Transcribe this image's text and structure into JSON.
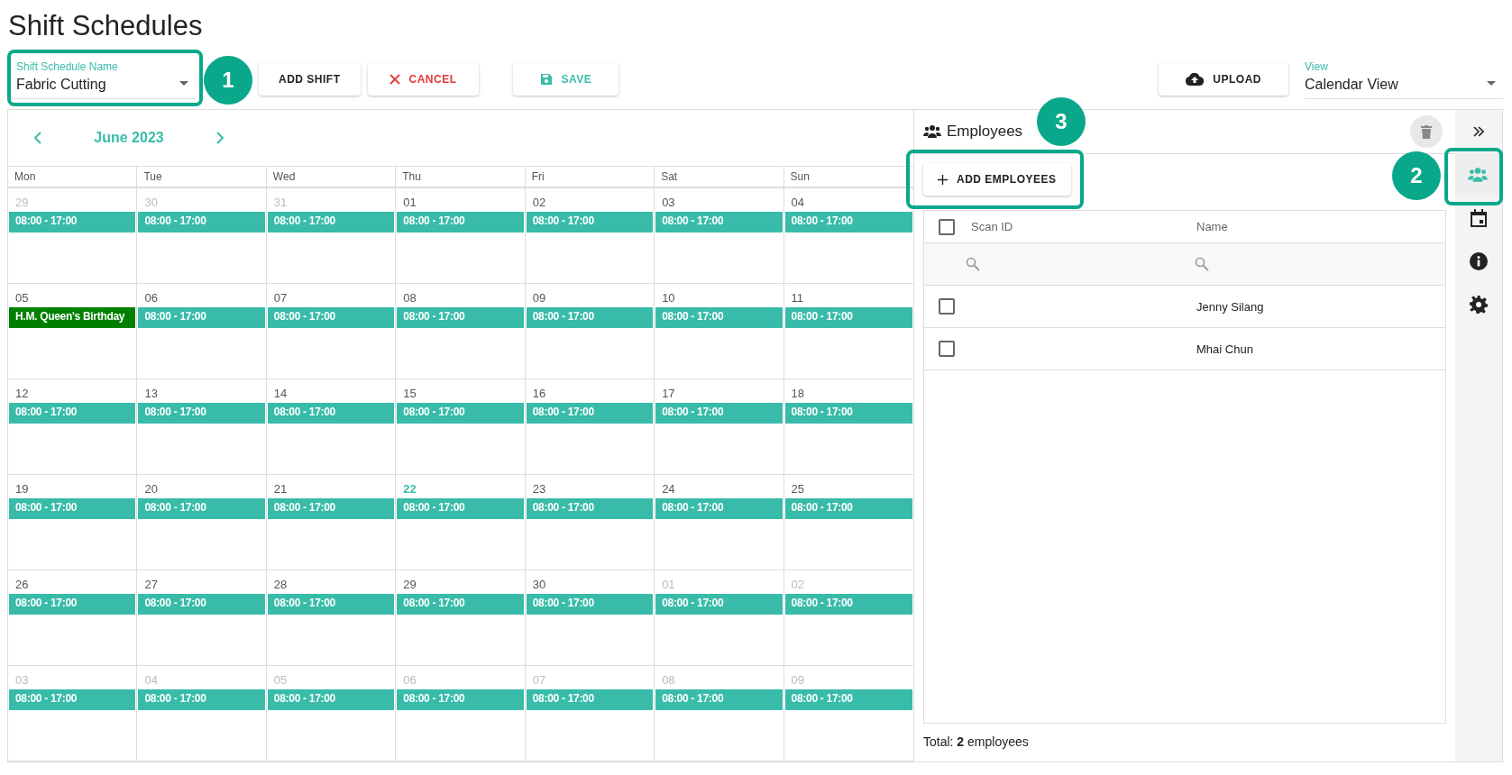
{
  "page_title": "Shift Schedules",
  "schedule_field": {
    "label": "Shift Schedule Name",
    "value": "Fabric Cutting"
  },
  "toolbar": [
    {
      "kind": "add",
      "label": "ADD SHIFT"
    },
    {
      "kind": "cancel",
      "label": "CANCEL"
    },
    {
      "kind": "save",
      "label": "SAVE"
    }
  ],
  "upload_button": {
    "label": "UPLOAD"
  },
  "view_field": {
    "label": "View",
    "value": "Calendar View"
  },
  "calendar": {
    "month": "June 2023",
    "weekdays": [
      "Mon",
      "Tue",
      "Wed",
      "Thu",
      "Fri",
      "Sat",
      "Sun"
    ],
    "weeks": [
      [
        {
          "day": "29",
          "outside": true,
          "today": false,
          "event": {
            "label": "08:00 - 17:00",
            "kind": "shift"
          }
        },
        {
          "day": "30",
          "outside": true,
          "today": false,
          "event": {
            "label": "08:00 - 17:00",
            "kind": "shift"
          }
        },
        {
          "day": "31",
          "outside": true,
          "today": false,
          "event": {
            "label": "08:00 - 17:00",
            "kind": "shift"
          }
        },
        {
          "day": "01",
          "outside": false,
          "today": false,
          "event": {
            "label": "08:00 - 17:00",
            "kind": "shift"
          }
        },
        {
          "day": "02",
          "outside": false,
          "today": false,
          "event": {
            "label": "08:00 - 17:00",
            "kind": "shift"
          }
        },
        {
          "day": "03",
          "outside": false,
          "today": false,
          "event": {
            "label": "08:00 - 17:00",
            "kind": "shift"
          }
        },
        {
          "day": "04",
          "outside": false,
          "today": false,
          "event": {
            "label": "08:00 - 17:00",
            "kind": "shift"
          }
        }
      ],
      [
        {
          "day": "05",
          "outside": false,
          "today": false,
          "event": {
            "label": "H.M. Queen's Birthday",
            "kind": "holiday"
          }
        },
        {
          "day": "06",
          "outside": false,
          "today": false,
          "event": {
            "label": "08:00 - 17:00",
            "kind": "shift"
          }
        },
        {
          "day": "07",
          "outside": false,
          "today": false,
          "event": {
            "label": "08:00 - 17:00",
            "kind": "shift"
          }
        },
        {
          "day": "08",
          "outside": false,
          "today": false,
          "event": {
            "label": "08:00 - 17:00",
            "kind": "shift"
          }
        },
        {
          "day": "09",
          "outside": false,
          "today": false,
          "event": {
            "label": "08:00 - 17:00",
            "kind": "shift"
          }
        },
        {
          "day": "10",
          "outside": false,
          "today": false,
          "event": {
            "label": "08:00 - 17:00",
            "kind": "shift"
          }
        },
        {
          "day": "11",
          "outside": false,
          "today": false,
          "event": {
            "label": "08:00 - 17:00",
            "kind": "shift"
          }
        }
      ],
      [
        {
          "day": "12",
          "outside": false,
          "today": false,
          "event": {
            "label": "08:00 - 17:00",
            "kind": "shift"
          }
        },
        {
          "day": "13",
          "outside": false,
          "today": false,
          "event": {
            "label": "08:00 - 17:00",
            "kind": "shift"
          }
        },
        {
          "day": "14",
          "outside": false,
          "today": false,
          "event": {
            "label": "08:00 - 17:00",
            "kind": "shift"
          }
        },
        {
          "day": "15",
          "outside": false,
          "today": false,
          "event": {
            "label": "08:00 - 17:00",
            "kind": "shift"
          }
        },
        {
          "day": "16",
          "outside": false,
          "today": false,
          "event": {
            "label": "08:00 - 17:00",
            "kind": "shift"
          }
        },
        {
          "day": "17",
          "outside": false,
          "today": false,
          "event": {
            "label": "08:00 - 17:00",
            "kind": "shift"
          }
        },
        {
          "day": "18",
          "outside": false,
          "today": false,
          "event": {
            "label": "08:00 - 17:00",
            "kind": "shift"
          }
        }
      ],
      [
        {
          "day": "19",
          "outside": false,
          "today": false,
          "event": {
            "label": "08:00 - 17:00",
            "kind": "shift"
          }
        },
        {
          "day": "20",
          "outside": false,
          "today": false,
          "event": {
            "label": "08:00 - 17:00",
            "kind": "shift"
          }
        },
        {
          "day": "21",
          "outside": false,
          "today": false,
          "event": {
            "label": "08:00 - 17:00",
            "kind": "shift"
          }
        },
        {
          "day": "22",
          "outside": false,
          "today": true,
          "event": {
            "label": "08:00 - 17:00",
            "kind": "shift"
          }
        },
        {
          "day": "23",
          "outside": false,
          "today": false,
          "event": {
            "label": "08:00 - 17:00",
            "kind": "shift"
          }
        },
        {
          "day": "24",
          "outside": false,
          "today": false,
          "event": {
            "label": "08:00 - 17:00",
            "kind": "shift"
          }
        },
        {
          "day": "25",
          "outside": false,
          "today": false,
          "event": {
            "label": "08:00 - 17:00",
            "kind": "shift"
          }
        }
      ],
      [
        {
          "day": "26",
          "outside": false,
          "today": false,
          "event": {
            "label": "08:00 - 17:00",
            "kind": "shift"
          }
        },
        {
          "day": "27",
          "outside": false,
          "today": false,
          "event": {
            "label": "08:00 - 17:00",
            "kind": "shift"
          }
        },
        {
          "day": "28",
          "outside": false,
          "today": false,
          "event": {
            "label": "08:00 - 17:00",
            "kind": "shift"
          }
        },
        {
          "day": "29",
          "outside": false,
          "today": false,
          "event": {
            "label": "08:00 - 17:00",
            "kind": "shift"
          }
        },
        {
          "day": "30",
          "outside": false,
          "today": false,
          "event": {
            "label": "08:00 - 17:00",
            "kind": "shift"
          }
        },
        {
          "day": "01",
          "outside": true,
          "today": false,
          "event": {
            "label": "08:00 - 17:00",
            "kind": "shift"
          }
        },
        {
          "day": "02",
          "outside": true,
          "today": false,
          "event": {
            "label": "08:00 - 17:00",
            "kind": "shift"
          }
        }
      ],
      [
        {
          "day": "03",
          "outside": true,
          "today": false,
          "event": {
            "label": "08:00 - 17:00",
            "kind": "shift"
          }
        },
        {
          "day": "04",
          "outside": true,
          "today": false,
          "event": {
            "label": "08:00 - 17:00",
            "kind": "shift"
          }
        },
        {
          "day": "05",
          "outside": true,
          "today": false,
          "event": {
            "label": "08:00 - 17:00",
            "kind": "shift"
          }
        },
        {
          "day": "06",
          "outside": true,
          "today": false,
          "event": {
            "label": "08:00 - 17:00",
            "kind": "shift"
          }
        },
        {
          "day": "07",
          "outside": true,
          "today": false,
          "event": {
            "label": "08:00 - 17:00",
            "kind": "shift"
          }
        },
        {
          "day": "08",
          "outside": true,
          "today": false,
          "event": {
            "label": "08:00 - 17:00",
            "kind": "shift"
          }
        },
        {
          "day": "09",
          "outside": true,
          "today": false,
          "event": {
            "label": "08:00 - 17:00",
            "kind": "shift"
          }
        }
      ]
    ]
  },
  "employees_panel": {
    "title": "Employees",
    "add_button": "ADD EMPLOYEES",
    "columns": [
      "Scan ID",
      "Name"
    ],
    "select_all_checked": false,
    "rows": [
      {
        "scan_id_checked": false,
        "name": "Jenny Silang"
      },
      {
        "scan_id_checked": false,
        "name": "Mhai Chun"
      }
    ],
    "total": "Total: **2** employees"
  },
  "side_strip": [
    {
      "kind": "collapse",
      "selected": false
    },
    {
      "kind": "employees",
      "selected": true
    },
    {
      "kind": "calendar",
      "selected": false
    },
    {
      "kind": "info",
      "selected": false
    },
    {
      "kind": "settings",
      "selected": false
    }
  ],
  "callouts": [
    {
      "label": "1"
    },
    {
      "label": "2"
    },
    {
      "label": "3"
    }
  ]
}
